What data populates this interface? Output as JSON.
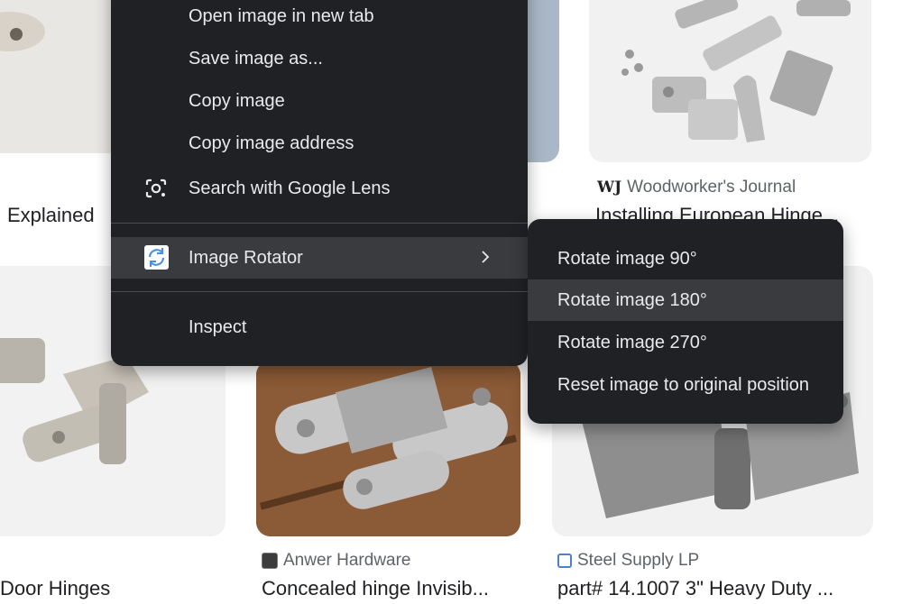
{
  "results": [
    {
      "source": "",
      "title": "Explained"
    },
    {
      "source": "Woodworker's Journal",
      "favicon_text": "WJ",
      "title": "Installing European Hinge..."
    },
    {
      "source": "",
      "title": "Door Hinges"
    },
    {
      "source": "Anwer Hardware",
      "title": "Concealed hinge Invisib..."
    },
    {
      "source": "Steel Supply LP",
      "title": "part# 14.1007 3\" Heavy Duty ..."
    }
  ],
  "context_menu": {
    "items": [
      {
        "label": "Open image in new tab"
      },
      {
        "label": "Save image as..."
      },
      {
        "label": "Copy image"
      },
      {
        "label": "Copy image address"
      },
      {
        "label": "Search with Google Lens",
        "icon": "google-lens-icon"
      },
      {
        "label": "Image Rotator",
        "icon": "image-rotator-icon",
        "submenu": true
      },
      {
        "label": "Inspect"
      }
    ]
  },
  "submenu": {
    "items": [
      {
        "label": "Rotate image 90°"
      },
      {
        "label": "Rotate image 180°"
      },
      {
        "label": "Rotate image 270°"
      },
      {
        "label": "Reset image to original position"
      }
    ]
  },
  "colors": {
    "menu_bg": "#202124",
    "menu_text": "#e8eaed",
    "hover_bg": "#3a3b3e"
  }
}
